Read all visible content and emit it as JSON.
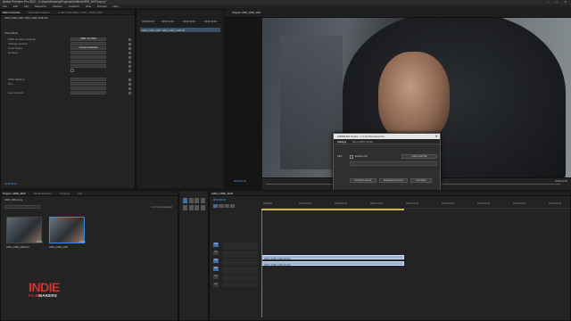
{
  "window": {
    "title": "Adobe Premiere Pro 2020 - C:\\Users\\Desktop\\Projects\\Untitled\\ARRI_MXF.prproj *",
    "controls": "–  ▢  ✕"
  },
  "menu": [
    "File",
    "Edit",
    "Clip",
    "Sequence",
    "Markers",
    "Graphics",
    "View",
    "Window",
    "Help"
  ],
  "source_panel": {
    "tabs": [
      "Effect Controls",
      "Essential Graphics",
      "Audio Track Mixer: A001_C006_1118",
      "Source: A001_C006_1118.mxf"
    ],
    "mini_header": "A001_C006_1118 * A001_C006_1118.mxf",
    "section": "Video Effects",
    "rows": [
      {
        "label": "ARRI Debayer Settings",
        "value": "ARRI v6.0 SDK"
      },
      {
        "label": "Settings Version",
        "value": ""
      },
      {
        "label": "Color Space",
        "value": "Camera Metadata"
      },
      {
        "label": "Debayer",
        "value": ""
      },
      {
        "label": "",
        "value": ""
      },
      {
        "label": "",
        "value": ""
      },
      {
        "label": "",
        "value": ""
      },
      {
        "label": "",
        "value": ""
      },
      {
        "label": "White Balance",
        "value": ""
      },
      {
        "label": "Tint",
        "value": ""
      },
      {
        "label": "",
        "value": ""
      },
      {
        "label": "Lens Correct",
        "value": ""
      }
    ]
  },
  "timecodes": [
    "00:00:00:00",
    "00:00:14:00",
    "00:00:32:00",
    "00:00:48:00"
  ],
  "program": {
    "tab": "Program: A001_C006_1118",
    "timecode_left": "00:00:00:00",
    "timecode_right": "00:00:02:06"
  },
  "dialog": {
    "title": "ARRIRAW Studio - 1.0 for Premiere Pro",
    "tabs": [
      "Settings",
      "About ARRI Studio"
    ],
    "field_label": "Path",
    "checkbox_label": "Enable Link",
    "browse_label": "Load Look File",
    "buttons": [
      "Activate License",
      "Deactivate License",
      "Purchase"
    ],
    "footer_link": "ARRIRAW Studio: Enabled",
    "ok": "OK",
    "cancel": "Cancel"
  },
  "project_panel": {
    "tabs": [
      "Project: ARRI_MXF",
      "Media Browser",
      "Libraries",
      "Info"
    ],
    "bin": "ARRI_MXF.prproj",
    "count": "1 of 2 items selected",
    "items": [
      {
        "name": "A001_C006_1118.mxf",
        "duration": "10:04"
      },
      {
        "name": "A001_C006_1118",
        "duration": "10:04"
      }
    ]
  },
  "timeline": {
    "tab": "A001_C006_1118",
    "timecode": "00:00:00:00",
    "ruler_marks": [
      "00:00:00",
      "00:00:04:23",
      "00:00:09:23",
      "00:00:14:23",
      "00:00:19:23",
      "00:00:24:23",
      "00:00:29:23",
      "00:00:34:23",
      "00:00:39:23"
    ],
    "tracks": [
      "V3",
      "V2",
      "V1",
      "A1",
      "A2",
      "A3"
    ],
    "clips": [
      "A001_C006_1118.mxf [V]",
      "A001_C006_1118.mxf [A]"
    ]
  },
  "watermark": {
    "line1": "INDIE",
    "line2a": "FILM",
    "line2b": "MAKERS"
  },
  "colors": {
    "accent": "#2d8ceb",
    "logo": "#d9322b",
    "clip_video": "#9db6d6",
    "clip_audio": "#9db6d6"
  }
}
